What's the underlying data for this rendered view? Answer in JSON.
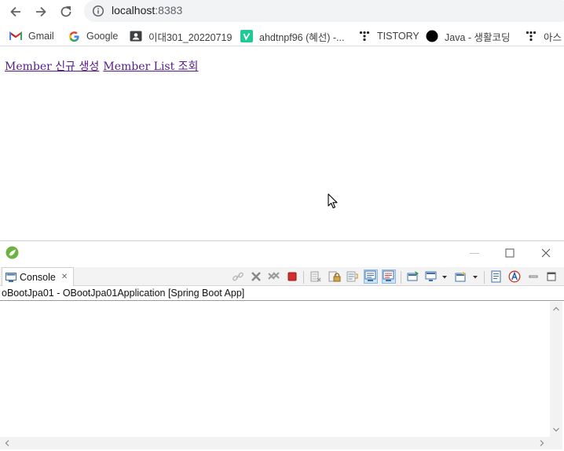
{
  "browser": {
    "url_host": "localhost",
    "url_port": ":8383",
    "bookmarks": [
      {
        "label": "Gmail",
        "icon": "gmail-icon"
      },
      {
        "label": "Google",
        "icon": "google-icon"
      },
      {
        "label": "이대301_20220719",
        "icon": "contact-card-icon"
      },
      {
        "label": "ahdtnpf96 (혜선) -...",
        "icon": "v-icon"
      },
      {
        "label": "TISTORY",
        "icon": "tistory-icon"
      },
      {
        "label": "Java - 생활코딩",
        "icon": "black-circle-icon"
      },
      {
        "label": "아스",
        "icon": "tistory-icon"
      }
    ]
  },
  "page": {
    "links": [
      {
        "label": "Member 신규 생성"
      },
      {
        "label": "Member List 조회"
      }
    ]
  },
  "ide": {
    "tab_label": "Console",
    "tab_close": "✕",
    "console_title": "oBootJpa01 - OBootJpa01Application [Spring Boot App]"
  },
  "colors": {
    "link_visited": "#551a8b",
    "spring_green": "#6db33f",
    "terminate_red": "#d32f2f"
  }
}
